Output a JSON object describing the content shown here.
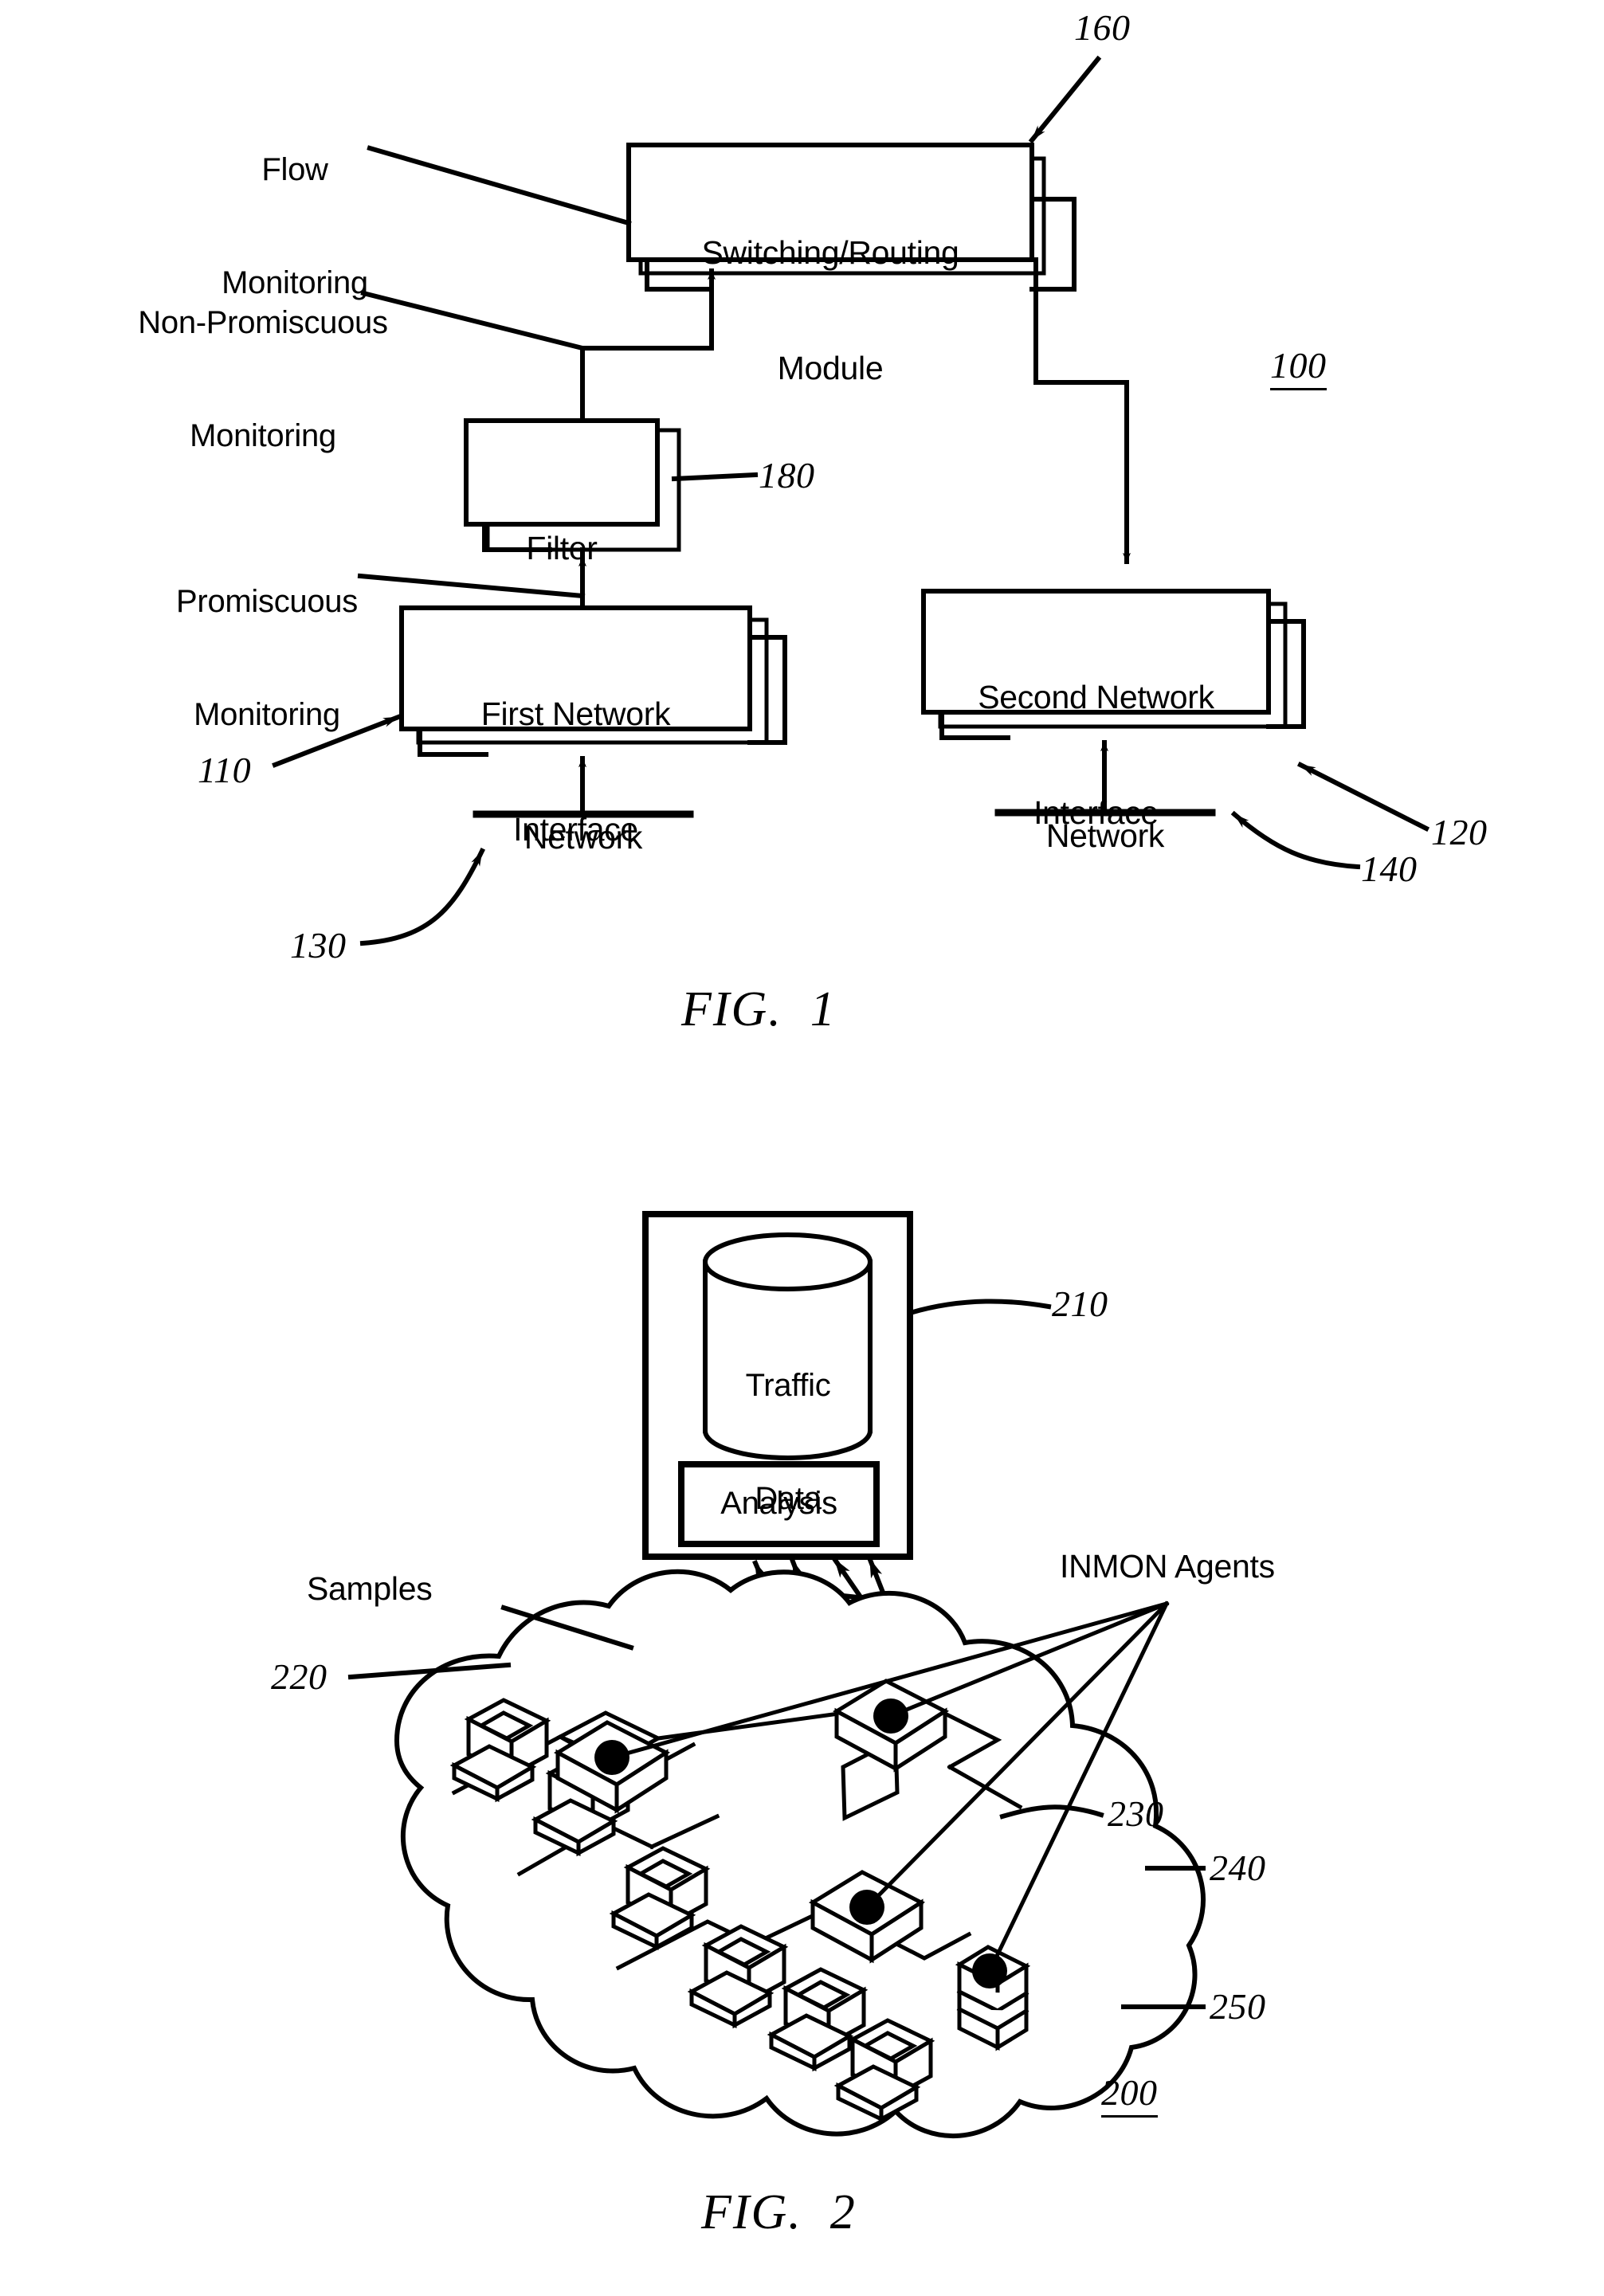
{
  "document": {
    "type": "patent-drawing-sheet",
    "background_color": "#ffffff",
    "ink_color": "#000000"
  },
  "figure1": {
    "caption": "FIG.  1",
    "system_ref": "100",
    "blocks": [
      {
        "id": "switching-routing-module",
        "line1": "Switching/Routing",
        "line2": "Module",
        "ref": "160"
      },
      {
        "id": "filter",
        "line1": "Filter",
        "line2": "",
        "ref": "180"
      },
      {
        "id": "first-network-interface",
        "line1": "First Network",
        "line2": "Interface",
        "ref": "110"
      },
      {
        "id": "second-network-interface",
        "line1": "Second Network",
        "line2": "Interface",
        "ref": "120"
      }
    ],
    "networks": [
      {
        "id": "network-first",
        "label": "Network",
        "ref": "130"
      },
      {
        "id": "network-second",
        "label": "Network",
        "ref": "140"
      }
    ],
    "annotations": [
      {
        "id": "flow-monitoring",
        "line1": "Flow",
        "line2": "Monitoring"
      },
      {
        "id": "non-promiscuous-monitoring",
        "line1": "Non-Promiscuous",
        "line2": "Monitoring"
      },
      {
        "id": "promiscuous-monitoring",
        "line1": "Promiscuous",
        "line2": "Monitoring"
      }
    ],
    "refs": {
      "module": "160",
      "filter": "180",
      "first_interface": "110",
      "second_interface": "120",
      "network_first": "130",
      "network_second": "140",
      "system": "100"
    }
  },
  "figure2": {
    "caption": "FIG.  2",
    "system_ref": "200",
    "collector": {
      "id": "collector-box",
      "ref": "210",
      "database": {
        "line1": "Traffic",
        "line2": "Data"
      },
      "analysis": {
        "label": "Analysis"
      }
    },
    "annotations": [
      {
        "id": "samples",
        "label": "Samples",
        "ref": "220"
      },
      {
        "id": "inmon-agents",
        "label": "INMON Agents"
      }
    ],
    "refs": {
      "collector": "210",
      "samples": "220",
      "agent_switch": "230",
      "cloud_network": "240",
      "agent_host": "250",
      "system": "200"
    },
    "agents_count": 4,
    "sample_arrows_count": 4,
    "workstations_count": 8,
    "switches_count": 3,
    "host_count": 1
  }
}
